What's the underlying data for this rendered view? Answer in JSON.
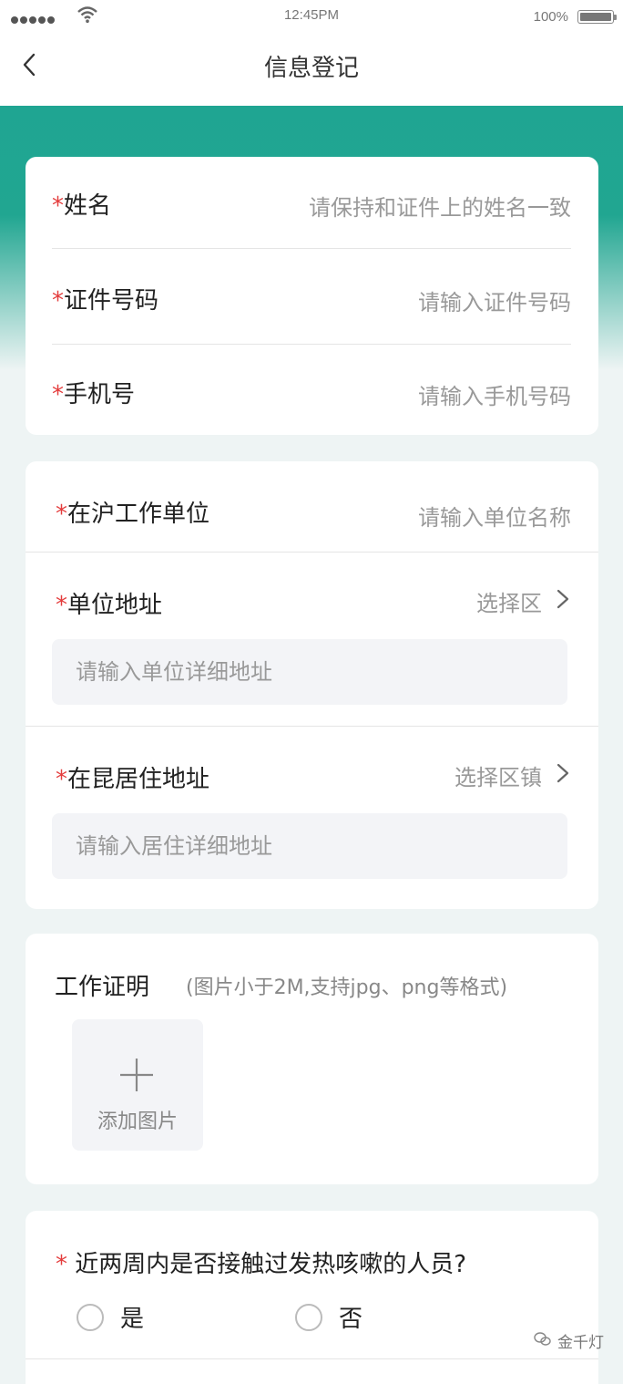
{
  "status_bar": {
    "time": "12:45PM",
    "battery": "100%"
  },
  "header": {
    "title": "信息登记"
  },
  "basic_info": {
    "name": {
      "label": "姓名",
      "placeholder": "请保持和证件上的姓名一致"
    },
    "id_number": {
      "label": "证件号码",
      "placeholder": "请输入证件号码"
    },
    "phone": {
      "label": "手机号",
      "placeholder": "请输入手机号码"
    }
  },
  "work_info": {
    "employer": {
      "label": "在沪工作单位",
      "placeholder": "请输入单位名称"
    },
    "employer_address": {
      "label": "单位地址",
      "select": "选择区",
      "detail_placeholder": "请输入单位详细地址"
    },
    "residence_address": {
      "label": "在昆居住地址",
      "select": "选择区镇",
      "detail_placeholder": "请输入居住详细地址"
    }
  },
  "proof": {
    "label": "工作证明",
    "hint": "(图片小于2M,支持jpg、png等格式)",
    "add_label": "添加图片"
  },
  "question": {
    "text": "近两周内是否接触过发热咳嗽的人员?",
    "options": [
      "是",
      "否"
    ]
  },
  "required_mark": "*",
  "watermark": "金千灯",
  "colors": {
    "accent": "#1fa592",
    "required": "#e43d3d"
  }
}
